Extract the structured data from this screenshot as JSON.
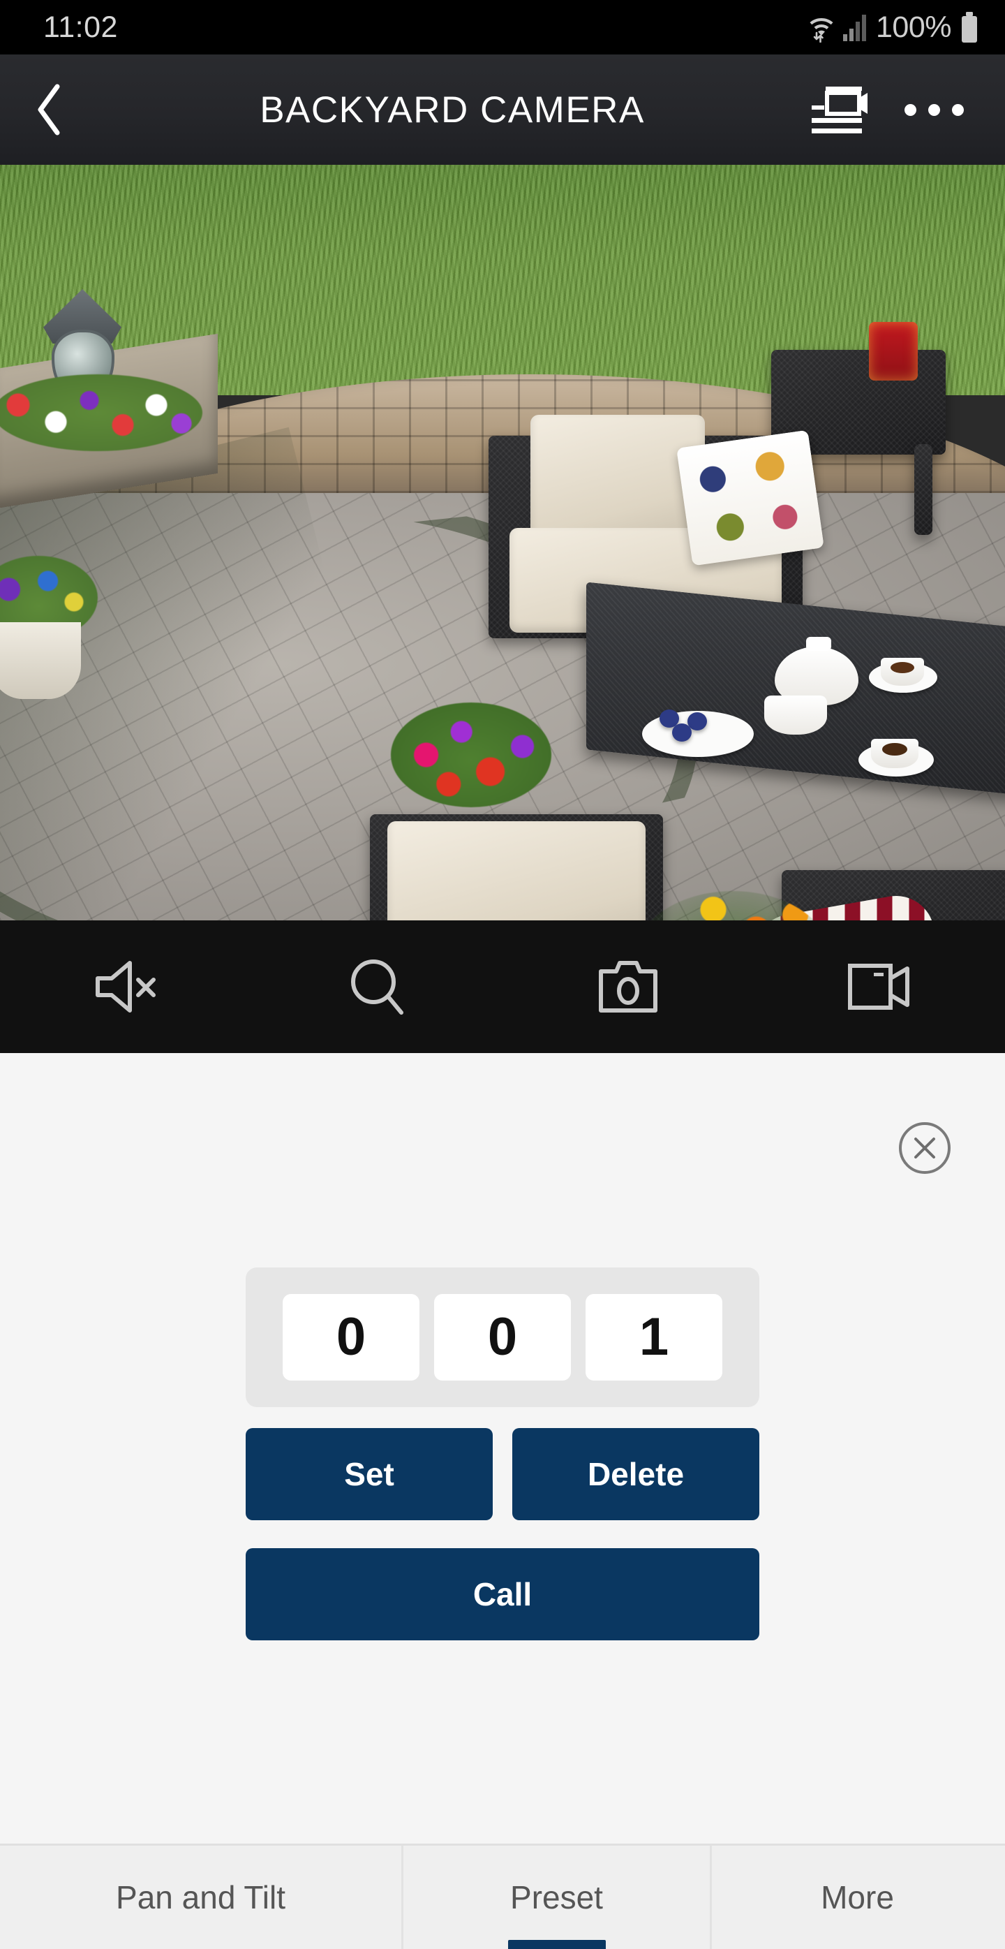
{
  "status_bar": {
    "clock": "11:02",
    "battery_percent": "100%",
    "icons": [
      "wifi-icon",
      "signal-bars-icon",
      "battery-icon"
    ]
  },
  "header": {
    "back_icon": "chevron-left-icon",
    "title": "BACKYARD CAMERA",
    "camera_list_icon": "camera-list-icon",
    "overflow_icon": "more-options-icon"
  },
  "video": {
    "alt": "Live backyard patio camera view with stone wall, pavers, wicker furniture and flowers",
    "controls": [
      {
        "name": "mute-button",
        "icon": "speaker-mute-icon",
        "label": "Mute"
      },
      {
        "name": "zoom-button",
        "icon": "magnifier-icon",
        "label": "Digital Zoom"
      },
      {
        "name": "snapshot-button",
        "icon": "photo-camera-icon",
        "label": "Snapshot"
      },
      {
        "name": "record-button",
        "icon": "video-camera-icon",
        "label": "Record"
      }
    ]
  },
  "preset_panel": {
    "close_icon": "close-circle-icon",
    "preset_digits": [
      "0",
      "0",
      "1"
    ],
    "preset_number": "001",
    "buttons": {
      "set": "Set",
      "delete": "Delete",
      "call": "Call"
    },
    "accent_color": "#0a3761"
  },
  "tabs": {
    "items": [
      {
        "label": "Pan and Tilt",
        "active": false
      },
      {
        "label": "Preset",
        "active": true
      },
      {
        "label": "More",
        "active": false
      }
    ]
  }
}
